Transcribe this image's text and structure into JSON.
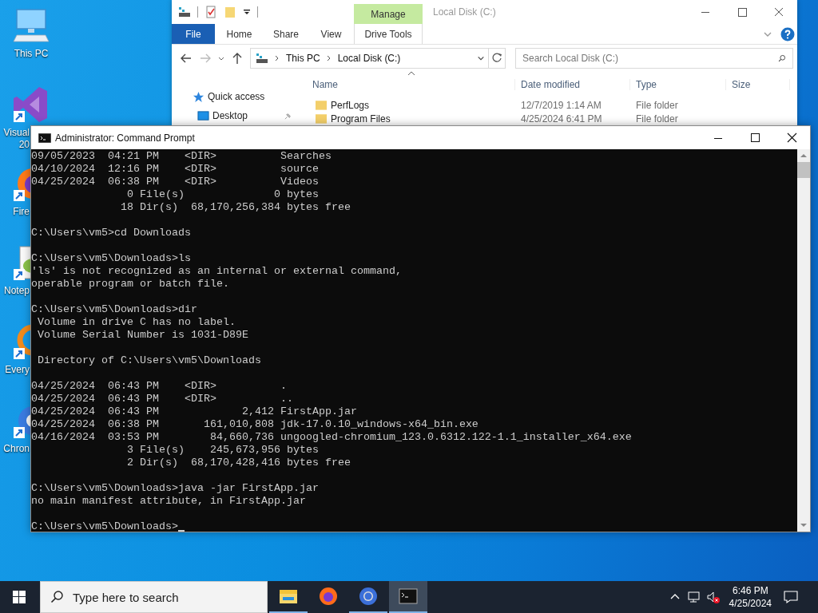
{
  "desktop": {
    "icons": [
      {
        "kind": "pc",
        "label": [
          "This PC"
        ]
      },
      {
        "kind": "vs",
        "label": [
          "Visual",
          "20"
        ]
      },
      {
        "kind": "firefox",
        "label": [
          "Fire"
        ]
      },
      {
        "kind": "notepad",
        "label": [
          "Notep"
        ]
      },
      {
        "kind": "everything",
        "label": [
          "Every"
        ]
      },
      {
        "kind": "chrome",
        "label": [
          "Chron"
        ]
      }
    ]
  },
  "explorer": {
    "title": "Local Disk (C:)",
    "context_tab": {
      "group": "Manage",
      "label": "Drive Tools"
    },
    "ribbon_tabs": [
      {
        "label": "File",
        "selected": true
      },
      {
        "label": "Home",
        "selected": false
      },
      {
        "label": "Share",
        "selected": false
      },
      {
        "label": "View",
        "selected": false
      }
    ],
    "address": [
      "This PC",
      "Local Disk (C:)"
    ],
    "search": {
      "placeholder": "Search Local Disk (C:)"
    },
    "nav": [
      {
        "kind": "star",
        "label": "Quick access",
        "pinned": false
      },
      {
        "kind": "desktop",
        "label": "Desktop",
        "pinned": true
      }
    ],
    "columns": [
      "Name",
      "Date modified",
      "Type",
      "Size"
    ],
    "rows": [
      {
        "name": "PerfLogs",
        "date": "12/7/2019 1:14 AM",
        "type": "File folder"
      },
      {
        "name": "Program Files",
        "date": "4/25/2024 6:41 PM",
        "type": "File folder"
      }
    ]
  },
  "cmd": {
    "title": "Administrator: Command Prompt",
    "cursor": true,
    "blocks": [
      [
        "09/05/2023  04:21 PM    <DIR>          Searches",
        "04/10/2024  12:16 PM    <DIR>          source",
        "04/25/2024  06:38 PM    <DIR>          Videos",
        "               0 File(s)              0 bytes",
        "              18 Dir(s)  68,170,256,384 bytes free"
      ],
      [
        "C:\\Users\\vm5>cd Downloads"
      ],
      [
        "C:\\Users\\vm5\\Downloads>ls",
        "'ls' is not recognized as an internal or external command,",
        "operable program or batch file."
      ],
      [
        "C:\\Users\\vm5\\Downloads>dir",
        " Volume in drive C has no label.",
        " Volume Serial Number is 1031-D89E"
      ],
      [
        " Directory of C:\\Users\\vm5\\Downloads"
      ],
      [
        "04/25/2024  06:43 PM    <DIR>          .",
        "04/25/2024  06:43 PM    <DIR>          ..",
        "04/25/2024  06:43 PM             2,412 FirstApp.jar",
        "04/25/2024  06:38 PM       161,010,808 jdk-17.0.10_windows-x64_bin.exe",
        "04/16/2024  03:53 PM        84,660,736 ungoogled-chromium_123.0.6312.122-1.1_installer_x64.exe",
        "               3 File(s)    245,673,956 bytes",
        "               2 Dir(s)  68,170,428,416 bytes free"
      ],
      [
        "C:\\Users\\vm5\\Downloads>java -jar FirstApp.jar",
        "no main manifest attribute, in FirstApp.jar"
      ],
      [
        "C:\\Users\\vm5\\Downloads>"
      ]
    ]
  },
  "taskbar": {
    "search": {
      "placeholder": "Type here to search"
    },
    "apps": [
      {
        "kind": "explorer",
        "running": true,
        "selected": false
      },
      {
        "kind": "firefox",
        "running": false,
        "selected": false
      },
      {
        "kind": "chrome",
        "running": true,
        "selected": false
      },
      {
        "kind": "cmd",
        "running": true,
        "selected": true
      }
    ],
    "time": "6:46 PM",
    "date": "4/25/2024"
  }
}
